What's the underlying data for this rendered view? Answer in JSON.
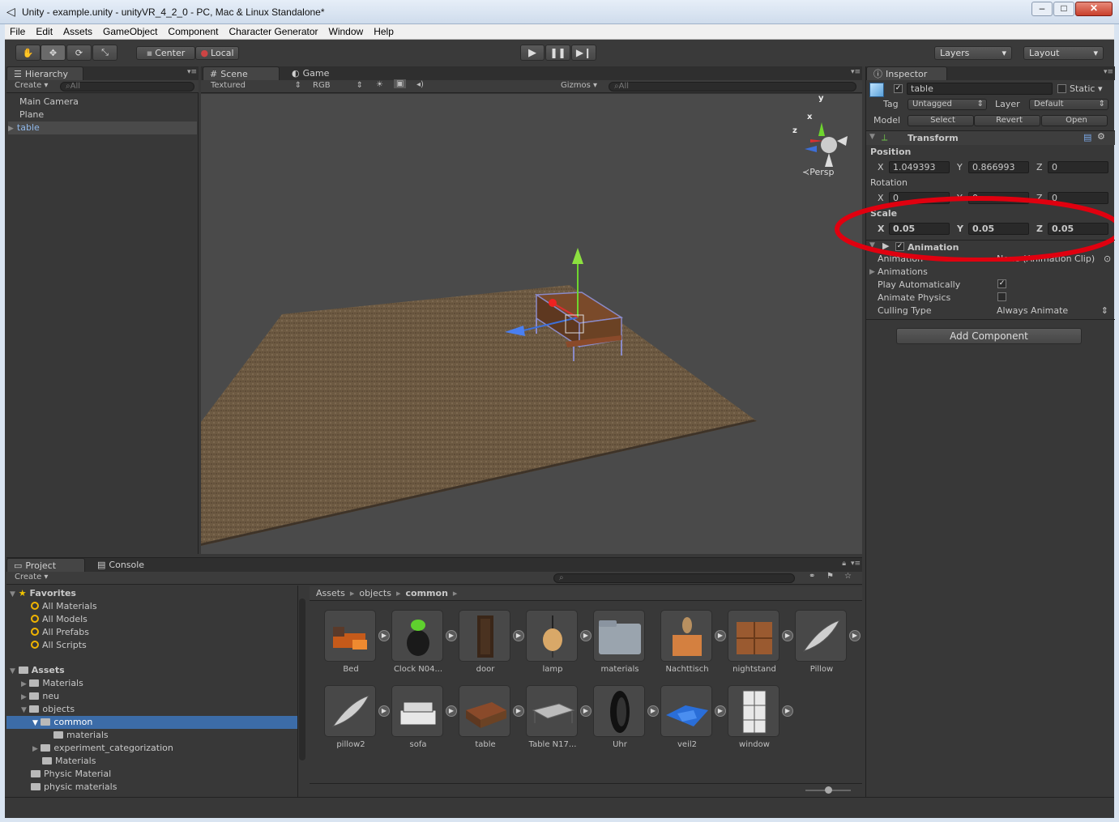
{
  "window": {
    "title": "Unity - example.unity - unityVR_4_2_0 - PC, Mac & Linux Standalone*"
  },
  "menu": [
    "File",
    "Edit",
    "Assets",
    "GameObject",
    "Component",
    "Character Generator",
    "Window",
    "Help"
  ],
  "toolbar": {
    "pivot": "Center",
    "space": "Local",
    "layers": "Layers",
    "layout": "Layout"
  },
  "hierarchy": {
    "tab": "Hierarchy",
    "create": "Create",
    "search_placeholder": "All",
    "items": [
      "Main Camera",
      "Plane",
      "table"
    ]
  },
  "scene": {
    "tab_scene": "Scene",
    "tab_game": "Game",
    "render_mode": "Textured",
    "color_mode": "RGB",
    "gizmos": "Gizmos",
    "search_placeholder": "All",
    "persp_label": "Persp",
    "axis_x": "x",
    "axis_y": "y",
    "axis_z": "z"
  },
  "inspector": {
    "tab": "Inspector",
    "object_name": "table",
    "static_label": "Static",
    "tag_label": "Tag",
    "tag_value": "Untagged",
    "layer_label": "Layer",
    "layer_value": "Default",
    "model_label": "Model",
    "select": "Select",
    "revert": "Revert",
    "open": "Open",
    "transform": {
      "title": "Transform",
      "position_label": "Position",
      "position": {
        "x": "1.049393",
        "y": "0.866993",
        "z": "0"
      },
      "rotation_label": "Rotation",
      "rotation": {
        "x": "0",
        "y": "0",
        "z": "0"
      },
      "scale_label": "Scale",
      "scale": {
        "x": "0.05",
        "y": "0.05",
        "z": "0.05"
      }
    },
    "animation": {
      "title": "Animation",
      "animation_label": "Animation",
      "animation_value": "None (Animation Clip)",
      "animations_label": "Animations",
      "play_auto_label": "Play Automatically",
      "play_auto": true,
      "animate_physics_label": "Animate Physics",
      "animate_physics": false,
      "culling_label": "Culling Type",
      "culling_value": "Always Animate"
    },
    "add_component": "Add Component",
    "highlight_color": "#e0000f"
  },
  "project": {
    "tab_project": "Project",
    "tab_console": "Console",
    "create": "Create",
    "favorites_label": "Favorites",
    "favorites": [
      "All Materials",
      "All Models",
      "All Prefabs",
      "All Scripts"
    ],
    "assets_label": "Assets",
    "tree": [
      {
        "label": "Materials",
        "indent": 1,
        "arrow": true
      },
      {
        "label": "neu",
        "indent": 1,
        "arrow": true
      },
      {
        "label": "objects",
        "indent": 1,
        "arrow": true,
        "open": true
      },
      {
        "label": "common",
        "indent": 2,
        "arrow": true,
        "open": true,
        "selected": true
      },
      {
        "label": "materials",
        "indent": 3,
        "arrow": false
      },
      {
        "label": "experiment_categorization",
        "indent": 2,
        "arrow": true
      },
      {
        "label": "Materials",
        "indent": 2,
        "arrow": false
      },
      {
        "label": "Physic Material",
        "indent": 1,
        "arrow": false
      },
      {
        "label": "physic materials",
        "indent": 1,
        "arrow": false
      }
    ],
    "breadcrumb": [
      "Assets",
      "objects",
      "common"
    ],
    "assets": [
      {
        "name": "Bed",
        "icon": "bed"
      },
      {
        "name": "Clock N04...",
        "icon": "clock"
      },
      {
        "name": "door",
        "icon": "door"
      },
      {
        "name": "lamp",
        "icon": "lamp"
      },
      {
        "name": "materials",
        "icon": "folder"
      },
      {
        "name": "Nachttisch",
        "icon": "nightstand"
      },
      {
        "name": "nightstand",
        "icon": "box"
      },
      {
        "name": "Pillow",
        "icon": "pillow"
      },
      {
        "name": "pillow2",
        "icon": "pillow"
      },
      {
        "name": "sofa",
        "icon": "sofa"
      },
      {
        "name": "table",
        "icon": "table"
      },
      {
        "name": "Table N17...",
        "icon": "table-frame"
      },
      {
        "name": "Uhr",
        "icon": "clock-ring"
      },
      {
        "name": "veil2",
        "icon": "cloth"
      },
      {
        "name": "window",
        "icon": "window"
      }
    ]
  }
}
